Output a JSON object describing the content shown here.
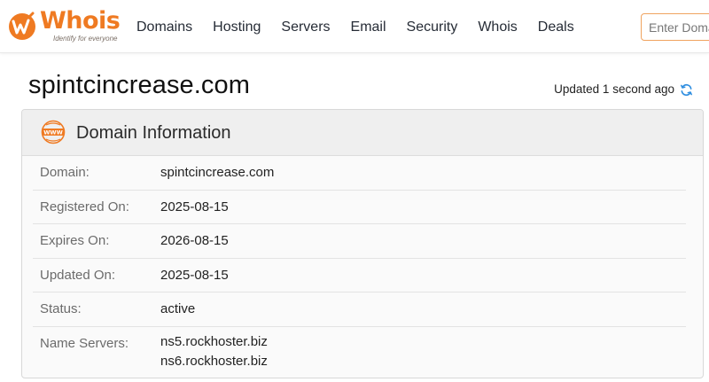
{
  "header": {
    "logo_text": "Whois",
    "logo_tagline": "Identify for everyone",
    "nav": [
      "Domains",
      "Hosting",
      "Servers",
      "Email",
      "Security",
      "Whois",
      "Deals"
    ],
    "search_placeholder": "Enter Domain"
  },
  "page": {
    "domain": "spintcincrease.com",
    "updated_text": "Updated 1 second ago"
  },
  "card": {
    "title": "Domain Information",
    "rows": [
      {
        "label": "Domain:",
        "value": "spintcincrease.com"
      },
      {
        "label": "Registered On:",
        "value": "2025-08-15"
      },
      {
        "label": "Expires On:",
        "value": "2026-08-15"
      },
      {
        "label": "Updated On:",
        "value": "2025-08-15"
      },
      {
        "label": "Status:",
        "value": "active"
      }
    ],
    "name_servers_label": "Name Servers:",
    "name_servers": [
      "ns5.rockhoster.biz",
      "ns6.rockhoster.biz"
    ]
  },
  "colors": {
    "brand": "#ef7a22",
    "accent_blue": "#2f8ee0"
  },
  "icons": {
    "logo": "whois-logo-icon",
    "refresh": "refresh-icon",
    "www": "www-icon"
  }
}
